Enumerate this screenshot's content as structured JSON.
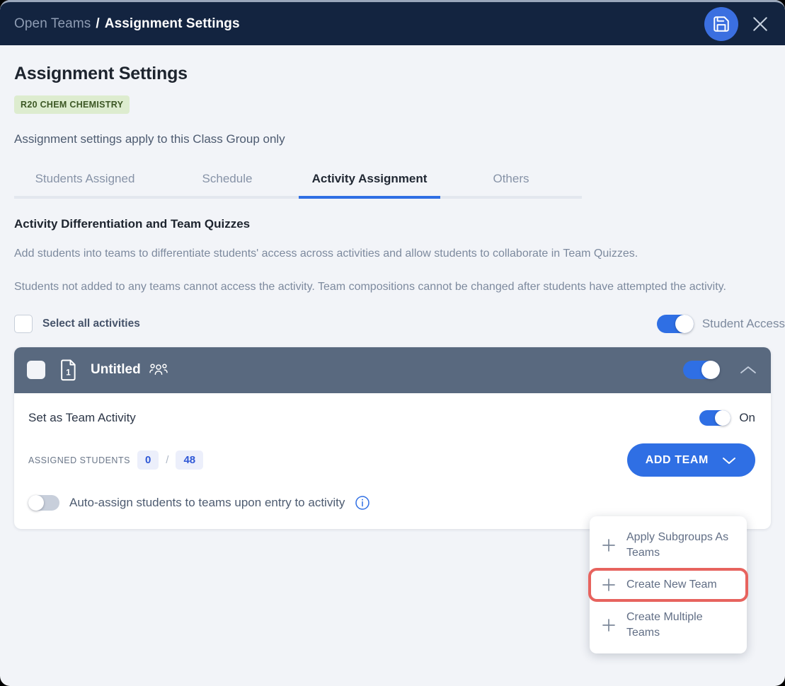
{
  "titlebar": {
    "breadcrumb_parent": "Open Teams",
    "breadcrumb_separator": "/",
    "breadcrumb_current": "Assignment Settings",
    "save_icon": "save-floppy-icon",
    "close_icon": "close-icon"
  },
  "header": {
    "page_title": "Assignment Settings",
    "class_badge": "R20 CHEM CHEMISTRY",
    "subtitle": "Assignment settings apply to this Class Group only"
  },
  "tabs": [
    {
      "label": "Students Assigned",
      "active": false
    },
    {
      "label": "Schedule",
      "active": false
    },
    {
      "label": "Activity Assignment",
      "active": true
    },
    {
      "label": "Others",
      "active": false
    }
  ],
  "section": {
    "title": "Activity Differentiation and Team Quizzes",
    "paragraph1": "Add students into teams to differentiate students' access across activities and allow students to collaborate in Team Quizzes.",
    "paragraph2": "Students not added to any teams cannot access the activity. Team compositions cannot be changed after students have attempted the activity."
  },
  "select_row": {
    "select_all_label": "Select all activities",
    "student_access_label": "Student Access",
    "student_access_on": true
  },
  "activity": {
    "title": "Untitled",
    "number": "1",
    "doc_icon": "document-number-icon",
    "team_icon": "team-people-icon",
    "collapse_icon": "chevron-up-icon",
    "header_toggle_on": true,
    "team_activity_label": "Set as Team Activity",
    "team_activity_state": "On",
    "assigned_students_label": "ASSIGNED STUDENTS",
    "assigned_count": "0",
    "assigned_separator": "/",
    "assigned_total": "48",
    "add_team_button": "ADD TEAM",
    "add_team_chevron": "chevron-down-icon",
    "auto_assign_label": "Auto-assign students to teams upon entry to activity",
    "auto_assign_on": false,
    "info_icon": "info-circle-icon"
  },
  "dropdown": {
    "items": [
      {
        "label": "Apply Subgroups As Teams",
        "icon": "plus-icon",
        "highlighted": false
      },
      {
        "label": "Create New Team",
        "icon": "plus-icon",
        "highlighted": true
      },
      {
        "label": "Create Multiple Teams",
        "icon": "plus-icon",
        "highlighted": false
      }
    ]
  },
  "colors": {
    "titlebar_bg": "#132440",
    "accent_blue": "#2f6fe4",
    "page_bg": "#f2f4f8",
    "activity_header": "#59697f",
    "badge_bg": "#ddeccf",
    "badge_text": "#3c5724",
    "highlight_red": "#e7635e"
  }
}
